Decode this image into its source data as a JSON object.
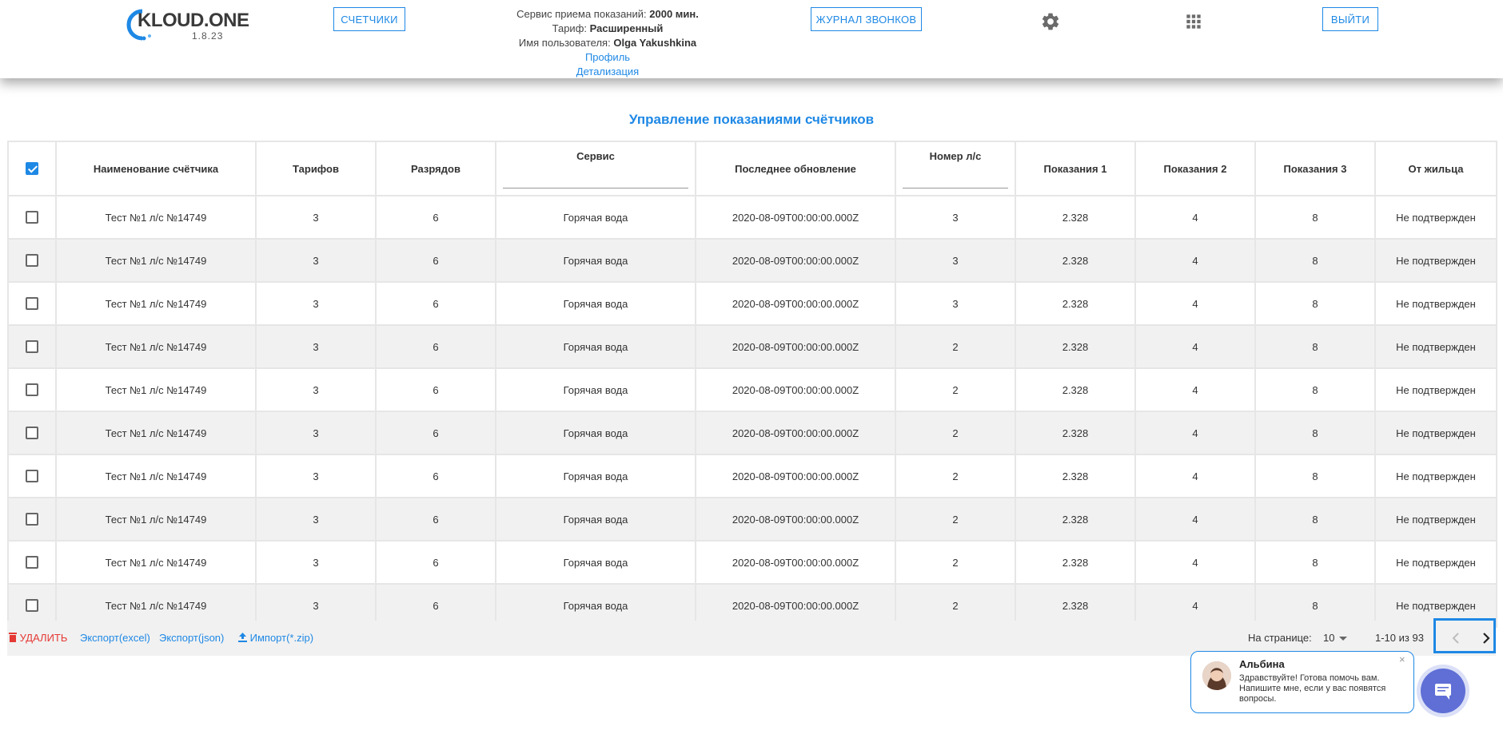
{
  "header": {
    "logo_text": "KLOUD.ONE",
    "logo_version": "1.8.23",
    "btn_counters": "СЧЕТЧИКИ",
    "btn_calls": "ЖУРНАЛ ЗВОНКОВ",
    "btn_exit": "ВЫЙТИ",
    "service_label": "Сервис приема показаний:",
    "service_value": "2000 мин.",
    "tariff_label": "Тариф:",
    "tariff_value": "Расширенный",
    "user_label": "Имя пользователя:",
    "user_value": "Olga Yakushkina",
    "profile_link": "Профиль",
    "detail_link": "Детализация",
    "settings_icon": "gear-icon",
    "apps_icon": "apps-grid-icon"
  },
  "page_title": "Управление показаниями счётчиков",
  "table": {
    "columns": [
      "Наименование счётчика",
      "Тарифов",
      "Разрядов",
      "Сервис",
      "Последнее обновление",
      "Номер л/с",
      "Показания 1",
      "Показания 2",
      "Показания 3",
      "От жильца"
    ],
    "rows": [
      [
        "Тест №1 л/с №14749",
        "3",
        "6",
        "Горячая вода",
        "2020-08-09T00:00:00.000Z",
        "3",
        "2.328",
        "4",
        "8",
        "Не подтвержден"
      ],
      [
        "Тест №1 л/с №14749",
        "3",
        "6",
        "Горячая вода",
        "2020-08-09T00:00:00.000Z",
        "3",
        "2.328",
        "4",
        "8",
        "Не подтвержден"
      ],
      [
        "Тест №1 л/с №14749",
        "3",
        "6",
        "Горячая вода",
        "2020-08-09T00:00:00.000Z",
        "3",
        "2.328",
        "4",
        "8",
        "Не подтвержден"
      ],
      [
        "Тест №1 л/с №14749",
        "3",
        "6",
        "Горячая вода",
        "2020-08-09T00:00:00.000Z",
        "2",
        "2.328",
        "4",
        "8",
        "Не подтвержден"
      ],
      [
        "Тест №1 л/с №14749",
        "3",
        "6",
        "Горячая вода",
        "2020-08-09T00:00:00.000Z",
        "2",
        "2.328",
        "4",
        "8",
        "Не подтвержден"
      ],
      [
        "Тест №1 л/с №14749",
        "3",
        "6",
        "Горячая вода",
        "2020-08-09T00:00:00.000Z",
        "2",
        "2.328",
        "4",
        "8",
        "Не подтвержден"
      ],
      [
        "Тест №1 л/с №14749",
        "3",
        "6",
        "Горячая вода",
        "2020-08-09T00:00:00.000Z",
        "2",
        "2.328",
        "4",
        "8",
        "Не подтвержден"
      ],
      [
        "Тест №1 л/с №14749",
        "3",
        "6",
        "Горячая вода",
        "2020-08-09T00:00:00.000Z",
        "2",
        "2.328",
        "4",
        "8",
        "Не подтвержден"
      ],
      [
        "Тест №1 л/с №14749",
        "3",
        "6",
        "Горячая вода",
        "2020-08-09T00:00:00.000Z",
        "2",
        "2.328",
        "4",
        "8",
        "Не подтвержден"
      ],
      [
        "Тест №1 л/с №14749",
        "3",
        "6",
        "Горячая вода",
        "2020-08-09T00:00:00.000Z",
        "2",
        "2.328",
        "4",
        "8",
        "Не подтвержден"
      ]
    ]
  },
  "footer": {
    "delete": "УДАЛИТЬ",
    "export_excel": "Экспорт(excel)",
    "export_json": "Экспорт(json)",
    "import_zip": "Импорт(*.zip)",
    "per_page_label": "На странице:",
    "per_page_value": "10",
    "range": "1-10 из 93"
  },
  "chat": {
    "name": "Альбина",
    "message": "Здравствуйте! Готова помочь вам. Напишите мне, если у вас появятся вопросы.",
    "close": "×"
  },
  "colors": {
    "accent": "#1e88e5",
    "danger": "#e53935",
    "chat_fab": "#5f6fd6"
  }
}
